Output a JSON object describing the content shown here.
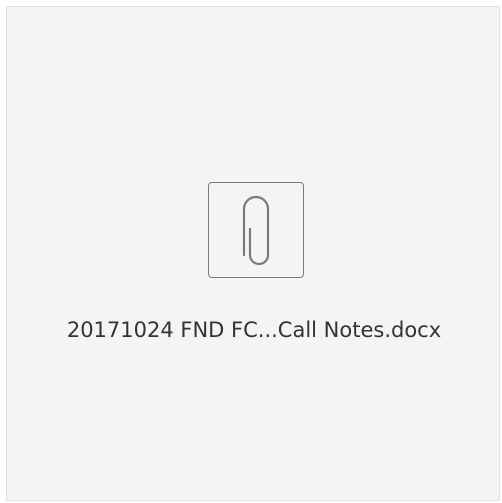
{
  "attachment": {
    "file_name": "20171024 FND FC...Call Notes.docx",
    "icon": "paperclip-icon",
    "colors": {
      "card_background": "#f4f4f4",
      "card_border": "#e2e2e2",
      "icon_stroke": "#7a7a7a",
      "text": "#333333"
    }
  }
}
